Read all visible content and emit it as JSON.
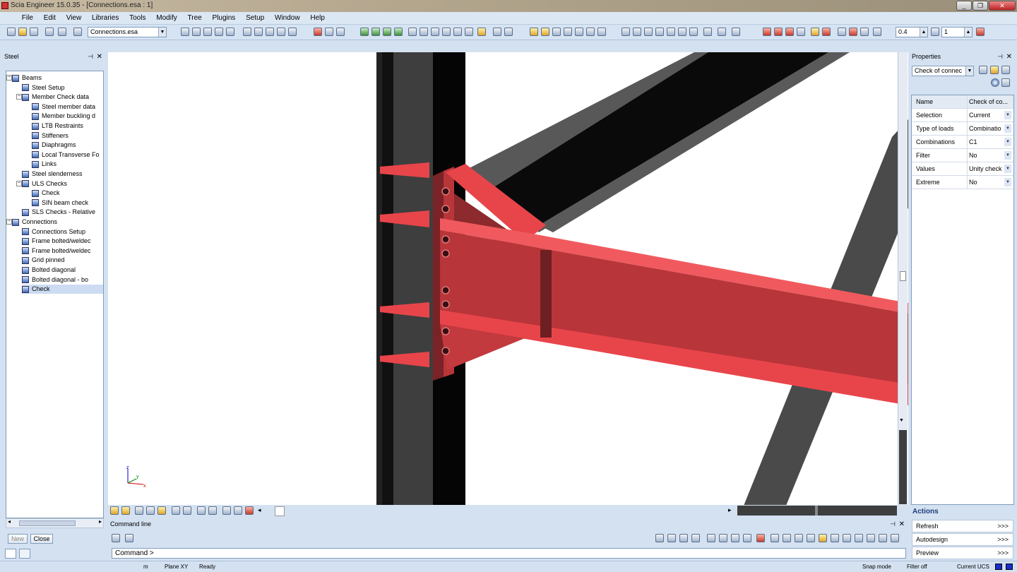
{
  "app": {
    "title": "Scia Engineer 15.0.35 - [Connections.esa : 1]"
  },
  "window_buttons": [
    "_",
    "❐",
    "✕"
  ],
  "menu": [
    "File",
    "Edit",
    "View",
    "Libraries",
    "Tools",
    "Modify",
    "Tree",
    "Plugins",
    "Setup",
    "Window",
    "Help"
  ],
  "toolbar": {
    "project_combo": "Connections.esa",
    "scale_value": "0.4",
    "count_value": "1"
  },
  "steel_panel": {
    "title": "Steel",
    "tree": [
      {
        "label": "Beams",
        "level": 0,
        "toggle": "−"
      },
      {
        "label": "Steel Setup",
        "level": 1
      },
      {
        "label": "Member Check data",
        "level": 1,
        "toggle": "−"
      },
      {
        "label": "Steel member data",
        "level": 2
      },
      {
        "label": "Member buckling d",
        "level": 2
      },
      {
        "label": "LTB Restraints",
        "level": 2
      },
      {
        "label": "Stiffeners",
        "level": 2
      },
      {
        "label": "Diaphragms",
        "level": 2
      },
      {
        "label": "Local Transverse Fo",
        "level": 2
      },
      {
        "label": "Links",
        "level": 2
      },
      {
        "label": "Steel slenderness",
        "level": 1
      },
      {
        "label": "ULS Checks",
        "level": 1,
        "toggle": "−"
      },
      {
        "label": "Check",
        "level": 2
      },
      {
        "label": "SIN beam check",
        "level": 2
      },
      {
        "label": "SLS Checks - Relative",
        "level": 1
      },
      {
        "label": "Connections",
        "level": 0,
        "toggle": "−"
      },
      {
        "label": "Connections Setup",
        "level": 1
      },
      {
        "label": "Frame bolted/weldec",
        "level": 1
      },
      {
        "label": "Frame bolted/weldec",
        "level": 1
      },
      {
        "label": "Grid pinned",
        "level": 1
      },
      {
        "label": "Bolted diagonal",
        "level": 1
      },
      {
        "label": "Bolted diagonal - bo",
        "level": 1
      },
      {
        "label": "Check",
        "level": 1,
        "selected": true
      }
    ],
    "new_button": "New",
    "close_button": "Close"
  },
  "properties": {
    "title": "Properties",
    "combo": "Check of connec",
    "rows": [
      {
        "key": "Name",
        "value": "Check of co..."
      },
      {
        "key": "Selection",
        "value": "Current",
        "dropdown": true
      },
      {
        "key": "Type of loads",
        "value": "Combinatio",
        "dropdown": true
      },
      {
        "key": "Combinations",
        "value": "C1",
        "dropdown": true
      },
      {
        "key": "Filter",
        "value": "No",
        "dropdown": true
      },
      {
        "key": "Values",
        "value": "Unity check",
        "dropdown": true
      },
      {
        "key": "Extreme",
        "value": "No",
        "dropdown": true
      }
    ]
  },
  "actions": {
    "title": "Actions",
    "items": [
      {
        "label": "Refresh",
        "more": ">>>"
      },
      {
        "label": "Autodesign",
        "more": ">>>"
      },
      {
        "label": "Preview",
        "more": ">>>"
      }
    ]
  },
  "command_line": {
    "title": "Command line",
    "prompt": "Command >"
  },
  "status_bar": {
    "units": "m",
    "plane": "Plane XY",
    "state": "Ready",
    "snap": "Snap mode",
    "filter": "Filter off",
    "ucs": "Current UCS"
  },
  "axis_labels": {
    "x": "x",
    "y": "y",
    "z": "z"
  },
  "colors": {
    "steel_red": "#e8454b",
    "member_gray": "#555555",
    "selection_blue": "#cddcf2"
  }
}
